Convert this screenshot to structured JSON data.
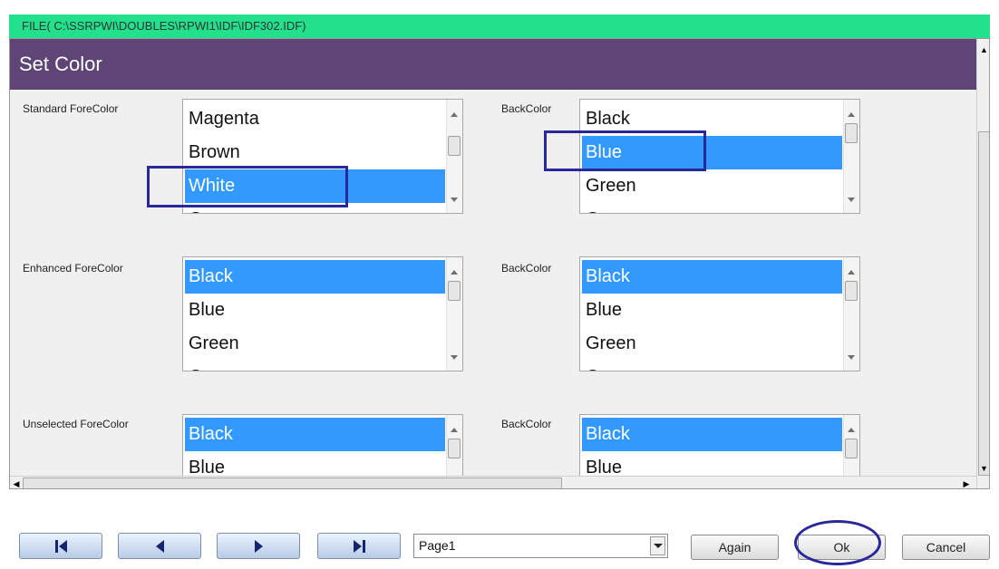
{
  "file_bar": {
    "text": "FILE( C:\\SSRPWI\\DOUBLES\\RPWI1\\IDF\\IDF302.IDF)"
  },
  "dialog": {
    "title": "Set Color"
  },
  "rows": [
    {
      "fore_label": "Standard ForeColor",
      "back_label": "BackColor",
      "fore_items": [
        "Magenta",
        "Brown",
        "White",
        "Gray"
      ],
      "fore_selected": "White",
      "back_items": [
        "Black",
        "Blue",
        "Green",
        "Gray"
      ],
      "back_selected": "Blue"
    },
    {
      "fore_label": "Enhanced ForeColor",
      "back_label": "BackColor",
      "fore_items": [
        "Black",
        "Blue",
        "Green",
        "Gray"
      ],
      "fore_selected": "Black",
      "back_items": [
        "Black",
        "Blue",
        "Green",
        "Gray"
      ],
      "back_selected": "Black"
    },
    {
      "fore_label": "Unselected ForeColor",
      "back_label": "BackColor",
      "fore_items": [
        "Black",
        "Blue"
      ],
      "fore_selected": "Black",
      "back_items": [
        "Black",
        "Blue"
      ],
      "back_selected": "Black"
    }
  ],
  "nav_buttons": [
    {
      "name": "first-page-button",
      "icon": "first-page-icon"
    },
    {
      "name": "previous-page-button",
      "icon": "previous-icon"
    },
    {
      "name": "next-page-button",
      "icon": "next-icon"
    },
    {
      "name": "last-page-button",
      "icon": "last-page-icon"
    }
  ],
  "page_select": {
    "value": "Page1"
  },
  "buttons": {
    "again": "Again",
    "ok": "Ok",
    "cancel": "Cancel"
  },
  "colors": {
    "file_bar_bg": "#22e08c",
    "title_bar_bg": "#5e4576",
    "selection": "#3399ff",
    "annotation": "#28289a"
  }
}
